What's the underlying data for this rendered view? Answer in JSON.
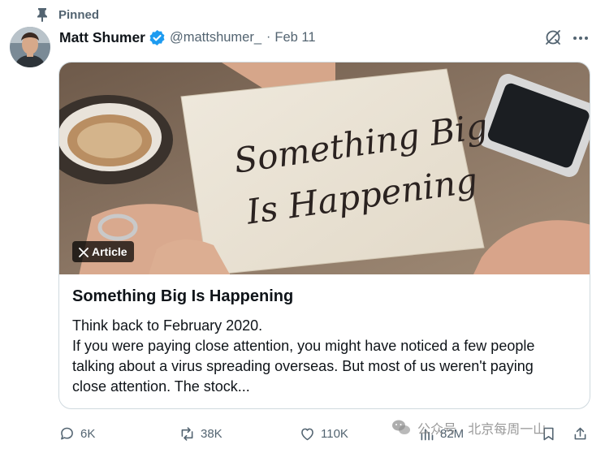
{
  "pinned": {
    "label": "Pinned"
  },
  "author": {
    "name": "Matt Shumer",
    "handle": "@mattshumer_",
    "separator": "·",
    "date": "Feb 11"
  },
  "article": {
    "badge": "Article",
    "image_text_lines": [
      "Something Big",
      "Is Happening"
    ],
    "title": "Something Big Is Happening",
    "body_lines": [
      "Think back to February 2020.",
      "If you were paying close attention, you might have noticed a few people",
      "talking about a virus spreading overseas. But most of us weren't paying",
      "close attention. The stock..."
    ]
  },
  "actions": {
    "replies": "6K",
    "reposts": "38K",
    "likes": "110K",
    "views": "82M"
  },
  "watermark": {
    "text": "公众号 · 北京每周一山"
  },
  "colors": {
    "verified": "#1d9bf0",
    "secondary_text": "#536471",
    "border": "#cfd9de",
    "text": "#0f1419"
  },
  "icons": [
    "pin-icon",
    "verified-badge-icon",
    "grok-icon",
    "more-icon",
    "x-logo-icon",
    "reply-icon",
    "repost-icon",
    "like-icon",
    "views-icon",
    "bookmark-icon",
    "share-icon",
    "wechat-icon"
  ]
}
